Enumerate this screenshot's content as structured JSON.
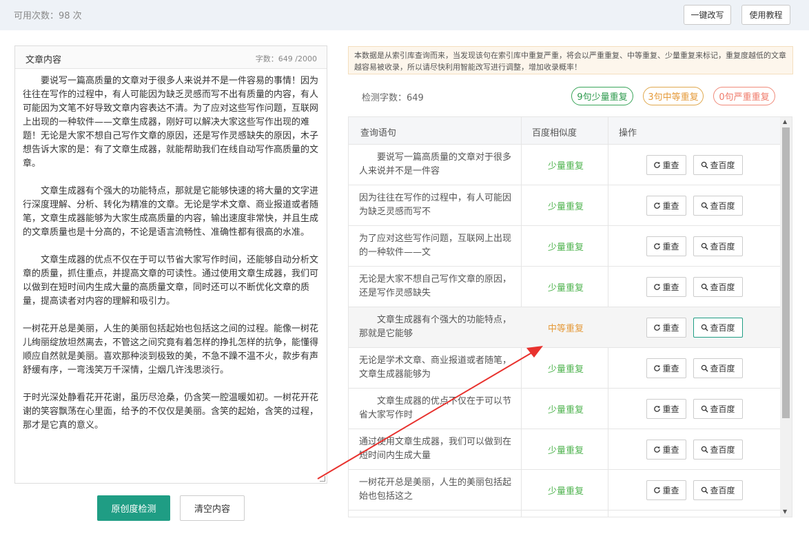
{
  "topbar": {
    "usage": "可用次数：98 次",
    "rewrite_label": "一键改写",
    "tutorial_label": "使用教程"
  },
  "editor": {
    "title": "文章内容",
    "count": "字数：649 /2000",
    "paragraphs": [
      "要说写一篇高质量的文章对于很多人来说并不是一件容易的事情！因为往往在写作的过程中，有人可能因为缺乏灵感而写不出有质量的内容，有人可能因为文笔不好导致文章内容表达不清。为了应对这些写作问题，互联网上出现的一种软件——文章生成器，刚好可以解决大家这些写作出现的难题！无论是大家不想自己写作文章的原因，还是写作灵感缺失的原因，木子想告诉大家的是：有了文章生成器，就能帮助我们在线自动写作高质量的文章。",
      "文章生成器有个强大的功能特点，那就是它能够快速的将大量的文字进行深度理解、分析、转化为精准的文章。无论是学术文章、商业报道或者随笔，文章生成器能够为大家生成高质量的内容，输出速度非常快，并且生成的文章质量也是十分高的，不论是语言流畅性、准确性都有很高的水准。",
      "文章生成器的优点不仅在于可以节省大家写作时间，还能够自动分析文章的质量，抓住重点，并提高文章的可读性。通过使用文章生成器，我们可以做到在短时间内生成大量的高质量文章，同时还可以不断优化文章的质量，提高读者对内容的理解和吸引力。",
      "一树花开总是美丽，人生的美丽包括起始也包括这之间的过程。能像一树花儿绚丽绽放坦然离去，不管这之间究竟有着怎样的挣扎怎样的抗争，能懂得顺应自然就是美丽。喜欢那种淡到极致的美，不急不躁不温不火，款步有声舒缓有序，一弯浅笑万千深情，尘烟几许浅思淡行。",
      "于时光深处静看花开花谢，虽历尽沧桑，仍含笑一腔温暖如初。一树花开花谢的笑容飘荡在心里面，给予的不仅仅是美丽。含笑的起始，含笑的过程，那才是它真的意义。"
    ]
  },
  "actions": {
    "check_label": "原创度检测",
    "clear_label": "清空内容"
  },
  "notice": "本数据是从索引库查询而来，当发现该句在索引库中重复严重，将会以严重重复、中等重复、少量重复来标记，重复度越低的文章越容易被收录，所以请尽快利用智能改写进行调整，增加收录概率！",
  "detect": {
    "count": "检测字数：649",
    "low": "9句少量重复",
    "mid": "3句中等重复",
    "high": "0句严重重复"
  },
  "table": {
    "headers": [
      "查询语句",
      "百度相似度",
      "操作"
    ],
    "recheck_label": "重查",
    "baidu_label": "查百度",
    "rows": [
      {
        "q": "要说写一篇高质量的文章对于很多人来说并不是一件容",
        "sim": "少量重复"
      },
      {
        "q": "因为往往在写作的过程中，有人可能因为缺乏灵感而写不",
        "sim": "少量重复"
      },
      {
        "q": "为了应对这些写作问题，互联网上出现的一种软件——文",
        "sim": "少量重复"
      },
      {
        "q": "无论是大家不想自己写作文章的原因，还是写作灵感缺失",
        "sim": "少量重复"
      },
      {
        "q": "文章生成器有个强大的功能特点，那就是它能够",
        "sim": "中等重复"
      },
      {
        "q": "无论是学术文章、商业报道或者随笔，文章生成器能够为",
        "sim": "少量重复"
      },
      {
        "q": "文章生成器的优点不仅在于可以节省大家写作时",
        "sim": "少量重复"
      },
      {
        "q": "通过使用文章生成器，我们可以做到在短时间内生成大量",
        "sim": "少量重复"
      },
      {
        "q": "一树花开总是美丽，人生的美丽包括起始也包括这之",
        "sim": "少量重复"
      }
    ]
  }
}
